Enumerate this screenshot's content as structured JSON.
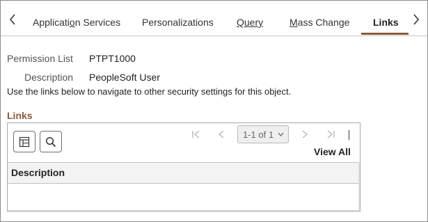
{
  "tabs": [
    {
      "label": "Application Services",
      "active": false
    },
    {
      "label": "Personalizations",
      "active": false
    },
    {
      "label": "Query",
      "active": false
    },
    {
      "label": "Mass Change",
      "active": false
    },
    {
      "label": "Links",
      "active": true
    }
  ],
  "tab_icons": {
    "prev": "chevron-left-icon",
    "next": "chevron-right-icon"
  },
  "fields": {
    "permission_list_label": "Permission List",
    "permission_list_value": "PTPT1000",
    "description_label": "Description",
    "description_value": "PeopleSoft User"
  },
  "info_text": "Use the links below to navigate to other security settings for this object.",
  "links_section": {
    "title": "Links",
    "pagination": {
      "range": "1-1 of 1"
    },
    "view_all": "View All",
    "columns": [
      "Description"
    ],
    "rows": []
  },
  "colors": {
    "accent": "#8b5a3c"
  }
}
